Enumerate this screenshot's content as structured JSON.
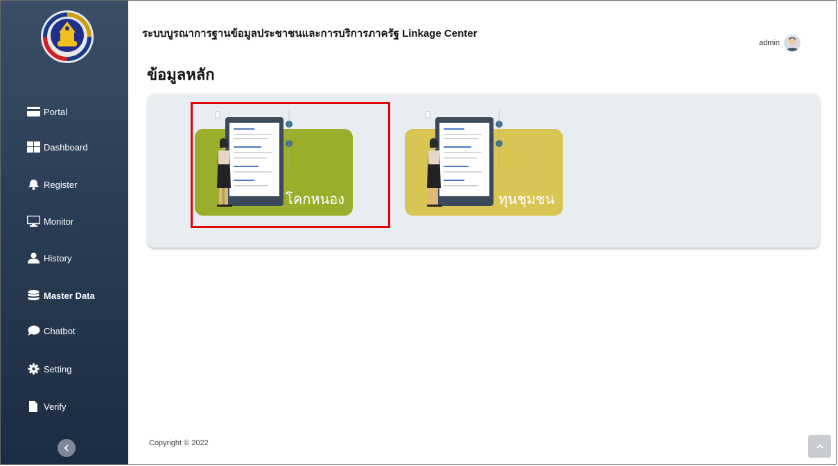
{
  "header": {
    "system_title": "ระบบบูรณาการฐานข้อมูลประชาชนและการบริการภาครัฐ Linkage Center",
    "user_name": "admin"
  },
  "logo": {
    "text": "กรมการพัฒนาชุมชน"
  },
  "sidebar": {
    "items": [
      {
        "label": "Portal",
        "icon": "card-icon"
      },
      {
        "label": "Dashboard",
        "icon": "grid-icon"
      },
      {
        "label": "Register",
        "icon": "bell-icon"
      },
      {
        "label": "Monitor",
        "icon": "monitor-icon"
      },
      {
        "label": "History",
        "icon": "user-icon"
      },
      {
        "label": "Master Data",
        "icon": "database-icon",
        "active": true
      },
      {
        "label": "Chatbot",
        "icon": "chat-icon"
      },
      {
        "label": "Setting",
        "icon": "cog-icon"
      },
      {
        "label": "Verify",
        "icon": "file-icon"
      }
    ]
  },
  "main": {
    "page_title": "ข้อมูลหลัก",
    "cards": [
      {
        "label": "โคกหนอง",
        "color": "#9aae2b",
        "highlighted": true
      },
      {
        "label": "ทุนชุมชน",
        "color": "#d9c554"
      }
    ]
  },
  "footer": {
    "copyright": "Copyright © 2022"
  },
  "colors": {
    "sidebar_top": "#3b4e66",
    "sidebar_bottom": "#1c2c42",
    "panel_bg": "#e8edf2",
    "highlight": "#e00000"
  }
}
